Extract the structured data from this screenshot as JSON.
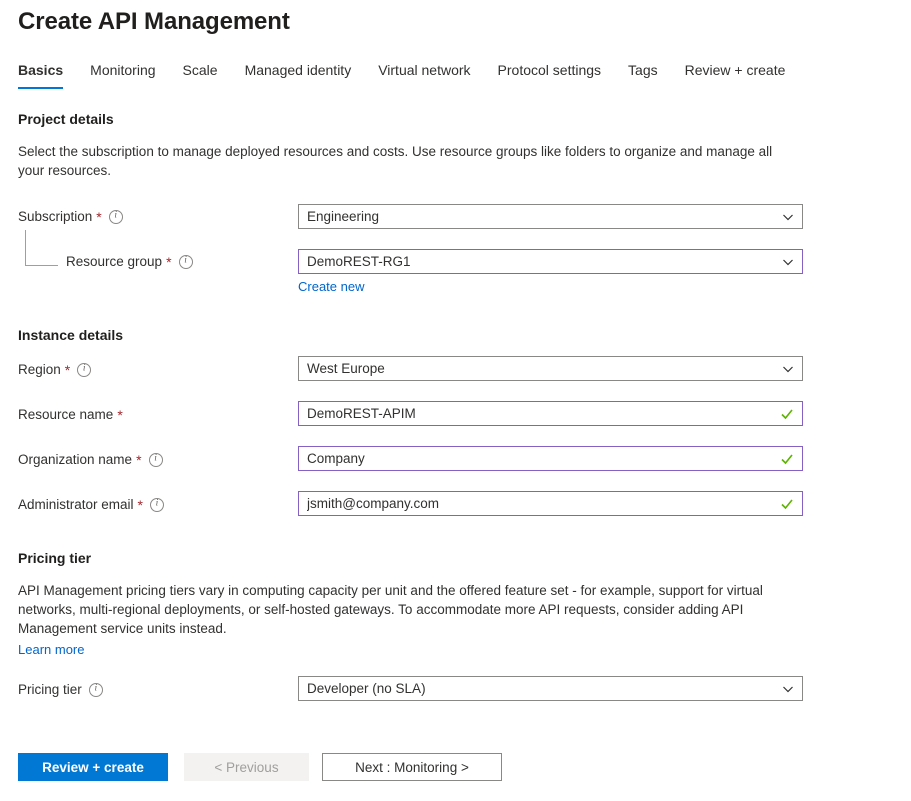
{
  "header": {
    "title": "Create API Management"
  },
  "tabs": [
    {
      "label": "Basics",
      "active": true
    },
    {
      "label": "Monitoring",
      "active": false
    },
    {
      "label": "Scale",
      "active": false
    },
    {
      "label": "Managed identity",
      "active": false
    },
    {
      "label": "Virtual network",
      "active": false
    },
    {
      "label": "Protocol settings",
      "active": false
    },
    {
      "label": "Tags",
      "active": false
    },
    {
      "label": "Review + create",
      "active": false
    }
  ],
  "project_details": {
    "heading": "Project details",
    "description": "Select the subscription to manage deployed resources and costs. Use resource groups like folders to organize and manage all your resources.",
    "subscription": {
      "label": "Subscription",
      "required": "*",
      "value": "Engineering"
    },
    "resource_group": {
      "label": "Resource group",
      "required": "*",
      "value": "DemoREST-RG1",
      "create_new_link": "Create new"
    }
  },
  "instance_details": {
    "heading": "Instance details",
    "region": {
      "label": "Region",
      "required": "*",
      "value": "West Europe"
    },
    "resource_name": {
      "label": "Resource name",
      "required": "*",
      "value": "DemoREST-APIM"
    },
    "organization_name": {
      "label": "Organization name",
      "required": "*",
      "value": "Company"
    },
    "administrator_email": {
      "label": "Administrator email",
      "required": "*",
      "value": "jsmith@company.com"
    }
  },
  "pricing_tier": {
    "heading": "Pricing tier",
    "description": "API Management pricing tiers vary in computing capacity per unit and the offered feature set - for example, support for virtual networks, multi-regional deployments, or self-hosted gateways. To accommodate more API requests, consider adding API Management service units instead.",
    "learn_more_link": "Learn more",
    "field": {
      "label": "Pricing tier",
      "value": "Developer (no SLA)"
    }
  },
  "footer": {
    "review_create": "Review + create",
    "previous": "< Previous",
    "next": "Next : Monitoring >"
  },
  "colors": {
    "accent": "#0078d4",
    "validated_border": "#8661c5",
    "required_asterisk": "#a4262c",
    "success_check": "#5db300",
    "link": "#0066cc"
  }
}
